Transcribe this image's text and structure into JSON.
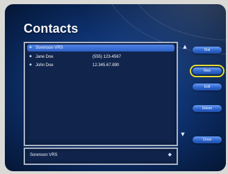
{
  "window": {
    "title": "Contacts"
  },
  "contacts": [
    {
      "name": "Sorenson VRS",
      "phone": "",
      "icon": "contact-icon"
    },
    {
      "name": "Jane Doe",
      "phone": "(555) 123-4567",
      "icon": "contact-icon"
    },
    {
      "name": "John Doe",
      "phone": "12.345.67.890",
      "icon": "contact-icon"
    }
  ],
  "buttons": {
    "dial": "Dial",
    "new": "New",
    "edit": "Edit",
    "delete": "Delete",
    "close": "Close"
  },
  "input": {
    "value": "Sorenson VRS",
    "icon": "contact-card-icon"
  },
  "colors": {
    "background": "#0d2f6a",
    "selected_row": "#2d60c6",
    "button": "#2f67cf",
    "focus": "#e6db34"
  }
}
